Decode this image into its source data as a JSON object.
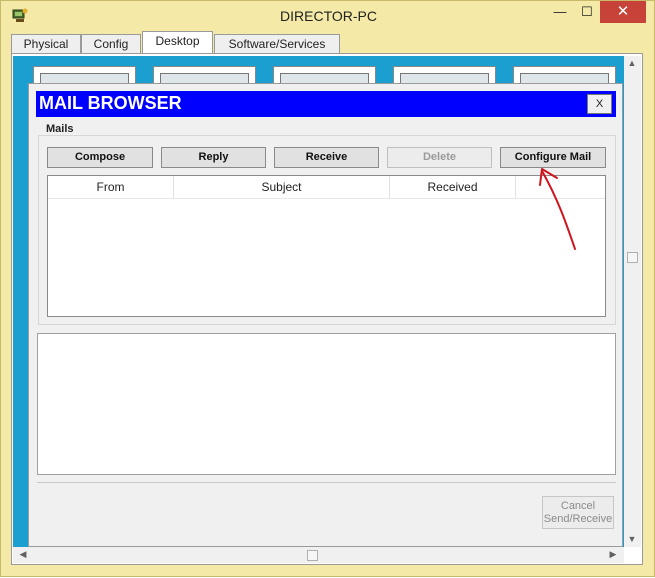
{
  "window": {
    "title": "DIRECTOR-PC",
    "min_glyph": "—",
    "max_glyph": "☐",
    "close_glyph": "✕",
    "app_icon": "packet-tracer-pc-icon"
  },
  "tabs": [
    {
      "label": "Physical"
    },
    {
      "label": "Config"
    },
    {
      "label": "Desktop",
      "active": true
    },
    {
      "label": "Software/Services"
    }
  ],
  "mail_browser": {
    "title": "MAIL BROWSER",
    "close_label": "X",
    "group_label": "Mails",
    "buttons": {
      "compose": "Compose",
      "reply": "Reply",
      "receive": "Receive",
      "delete": "Delete",
      "configure": "Configure Mail"
    },
    "columns": [
      "From",
      "Subject",
      "Received",
      ""
    ],
    "cancel_line1": "Cancel",
    "cancel_line2": "Send/Receive"
  },
  "colors": {
    "title_bar": "#f4e9a6",
    "mail_header": "#0000ff",
    "desktop_bg": "#1b9fd1",
    "annotation_arrow": "#d0141e",
    "close_button": "#c7433a"
  },
  "scroll_glyphs": {
    "up": "▲",
    "down": "▼",
    "left": "◀",
    "right": "▶"
  }
}
